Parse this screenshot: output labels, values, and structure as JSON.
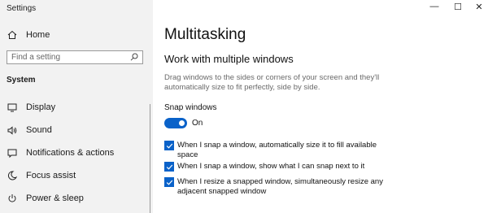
{
  "window": {
    "title": "Settings",
    "controls": {
      "minimize": "—",
      "maximize": "☐",
      "close": "✕"
    }
  },
  "sidebar": {
    "home": {
      "label": "Home",
      "icon": "home-icon"
    },
    "search": {
      "placeholder": "Find a setting",
      "icon": "search-icon"
    },
    "section_title": "System",
    "items": [
      {
        "label": "Display",
        "icon": "display-icon"
      },
      {
        "label": "Sound",
        "icon": "sound-icon"
      },
      {
        "label": "Notifications & actions",
        "icon": "notifications-icon"
      },
      {
        "label": "Focus assist",
        "icon": "focus-assist-icon"
      },
      {
        "label": "Power & sleep",
        "icon": "power-icon"
      }
    ]
  },
  "main": {
    "title": "Multitasking",
    "section": "Work with multiple windows",
    "description": "Drag windows to the sides or corners of your screen and they'll automatically size to fit perfectly, side by side.",
    "snap_label": "Snap windows",
    "toggle_state": "On",
    "options": [
      {
        "label": "When I snap a window, automatically size it to fill available space",
        "checked": true
      },
      {
        "label": "When I snap a window, show what I can snap next to it",
        "checked": true
      },
      {
        "label": "When I resize a snapped window, simultaneously resize any adjacent snapped window",
        "checked": true
      }
    ]
  },
  "colors": {
    "accent": "#0a62c9",
    "sidebar_bg": "#f2f2f2"
  }
}
